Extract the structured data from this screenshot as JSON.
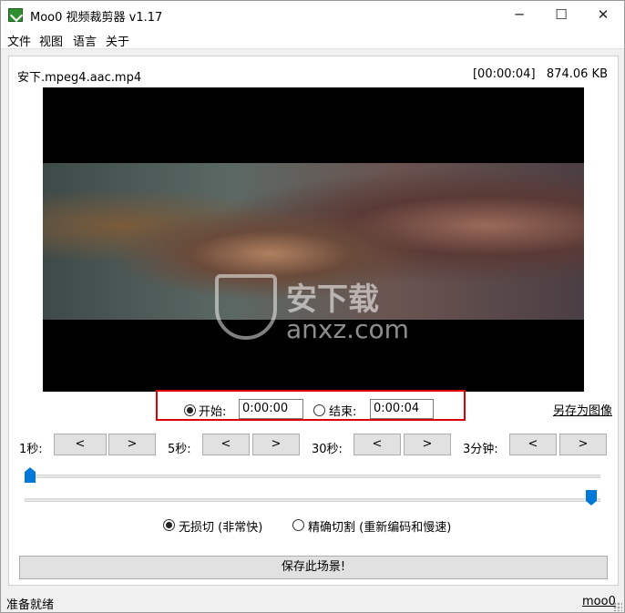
{
  "window": {
    "title": "Moo0 视频裁剪器 v1.17",
    "controls": {
      "minimize": "─",
      "maximize": "☐",
      "close": "✕"
    }
  },
  "menu": {
    "items": [
      "文件",
      "视图",
      "语言",
      "关于"
    ]
  },
  "file": {
    "name": "安下.mpeg4.aac.mp4",
    "duration": "[00:00:04]",
    "size": "874.06 KB"
  },
  "watermark": {
    "text": "安下载",
    "url": "anxz.com"
  },
  "trim": {
    "start_label": "开始:",
    "start_value": "0:00:00",
    "start_selected": true,
    "end_label": "结束:",
    "end_value": "0:00:04",
    "end_selected": false
  },
  "save_image_link": "另存为图像",
  "steps": [
    {
      "label": "1秒:",
      "back": "<",
      "forward": ">"
    },
    {
      "label": "5秒:",
      "back": "<",
      "forward": ">"
    },
    {
      "label": "30秒:",
      "back": "<",
      "forward": ">"
    },
    {
      "label": "3分钟:",
      "back": "<",
      "forward": ">"
    }
  ],
  "sliders": {
    "start_fraction": 0.0,
    "end_fraction": 1.0
  },
  "modes": [
    {
      "label": "无损切 (非常快)",
      "selected": true
    },
    {
      "label": "精确切割 (重新编码和慢速)",
      "selected": false
    }
  ],
  "save_scene_button": "保存此场景!",
  "status": {
    "text": "准备就绪",
    "link": "moo0"
  },
  "colors": {
    "accent": "#0078d7",
    "highlight_box": "#e00000",
    "video_bg": "#000000"
  },
  "icons": {
    "app": "moo0-app-icon",
    "radio_on": "radio-checked",
    "radio_off": "radio-unchecked"
  }
}
